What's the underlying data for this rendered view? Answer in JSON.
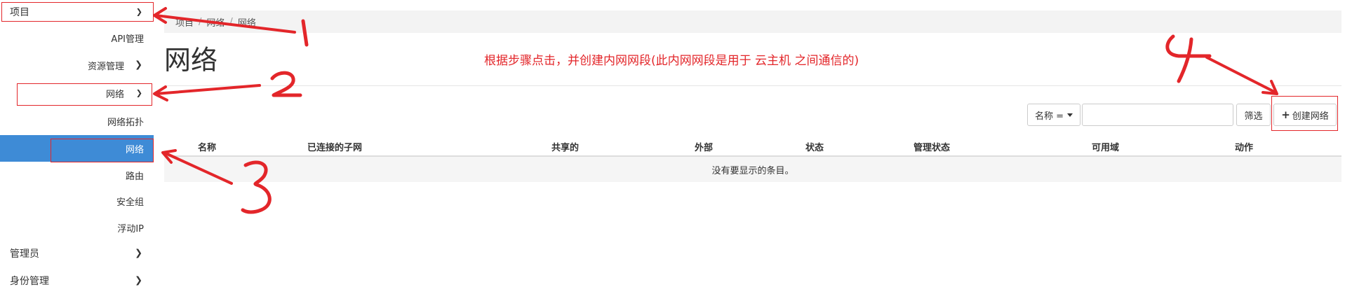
{
  "sidebar": {
    "project": "项目",
    "api_manage": "API管理",
    "resource_manage": "资源管理",
    "network_group": "网络",
    "network_topology": "网络拓扑",
    "network_active": "网络",
    "router": "路由",
    "security_group": "安全组",
    "floating_ip": "浮动IP",
    "admin": "管理员",
    "identity": "身份管理"
  },
  "breadcrumb": [
    "项目",
    "网络",
    "网络"
  ],
  "page_title": "网络",
  "instruction_note": "根据步骤点击，并创建内网网段(此内网网段是用于 云主机 之间通信的)",
  "toolbar": {
    "filter_field": "名称 =",
    "search_value": "",
    "filter_button": "筛选",
    "create_button": "创建网络"
  },
  "table": {
    "columns": [
      "名称",
      "已连接的子网",
      "共享的",
      "外部",
      "状态",
      "管理状态",
      "可用域",
      "动作"
    ],
    "empty_message": "没有要显示的条目。"
  },
  "annotations": {
    "steps": [
      "1",
      "2",
      "3",
      "4"
    ],
    "color": "#e3262a"
  },
  "colors": {
    "active_item": "#3e8bd6",
    "annotation_red": "#e3262a"
  }
}
